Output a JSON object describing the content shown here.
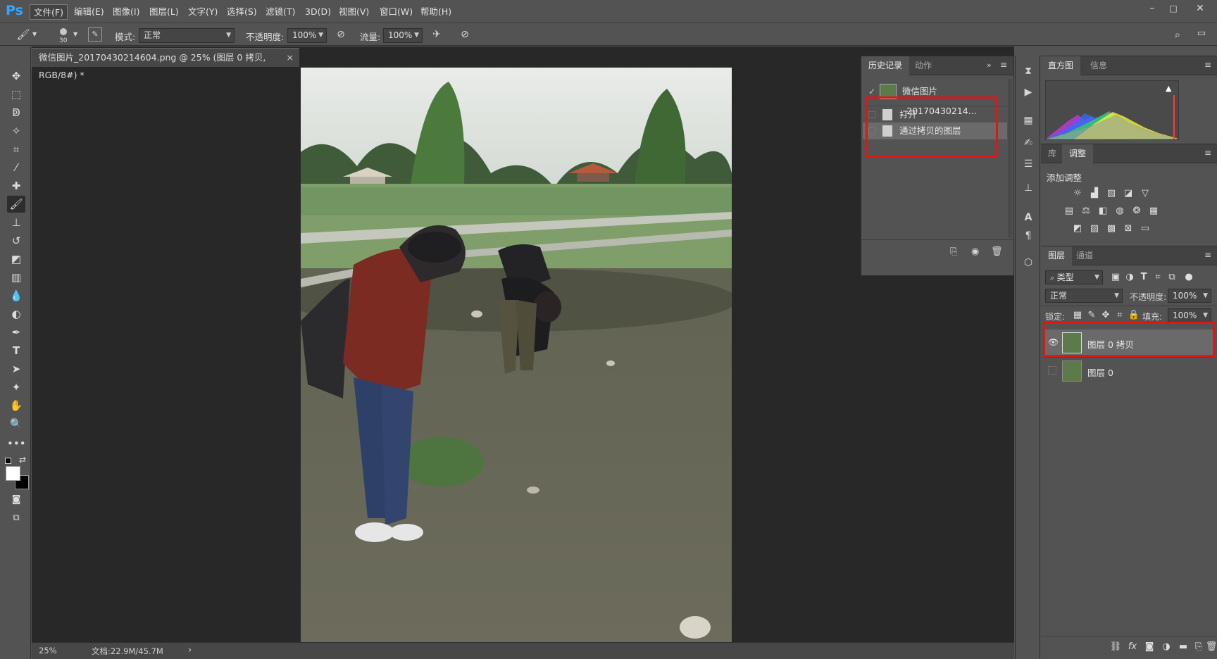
{
  "app": {
    "logo": "Ps"
  },
  "menu": [
    "文件(F)",
    "编辑(E)",
    "图像(I)",
    "图层(L)",
    "文字(Y)",
    "选择(S)",
    "滤镜(T)",
    "3D(D)",
    "视图(V)",
    "窗口(W)",
    "帮助(H)"
  ],
  "window_controls": {
    "minimize": "–",
    "maximize": "□",
    "close": "✕"
  },
  "options": {
    "brush_size": "30",
    "mode_label": "模式:",
    "mode_value": "正常",
    "opacity_label": "不透明度:",
    "opacity_value": "100%",
    "flow_label": "流量:",
    "flow_value": "100%"
  },
  "document": {
    "tab_title": "微信图片_20170430214604.png @ 25% (图层 0 拷贝, RGB/8#) *",
    "tab_close": "×",
    "zoom": "25%",
    "doc_size": "文档:22.9M/45.7M",
    "status_arrow": "›"
  },
  "history_panel": {
    "tabs": [
      "历史记录",
      "动作"
    ],
    "snapshot_label": "微信图片_20170430214...",
    "items": [
      "打开",
      "通过拷贝的图层"
    ]
  },
  "histogram_panel": {
    "tabs": [
      "直方图",
      "信息"
    ]
  },
  "adjust_panel": {
    "tabs": [
      "库",
      "调整"
    ],
    "title": "添加调整"
  },
  "layers_panel": {
    "tabs": [
      "图层",
      "通道"
    ],
    "filter_label": "类型",
    "blend_mode": "正常",
    "opacity_label": "不透明度:",
    "opacity_value": "100%",
    "lock_label": "锁定:",
    "fill_label": "填充:",
    "fill_value": "100%",
    "layers": [
      {
        "name": "图层 0 拷贝",
        "visible": true,
        "selected": true
      },
      {
        "name": "图层 0",
        "visible": false,
        "selected": false
      }
    ]
  },
  "colors": {
    "accent_red": "#e01515",
    "ps_blue": "#31a8ff",
    "panel_bg": "#535353",
    "canvas_bg": "#282828"
  }
}
